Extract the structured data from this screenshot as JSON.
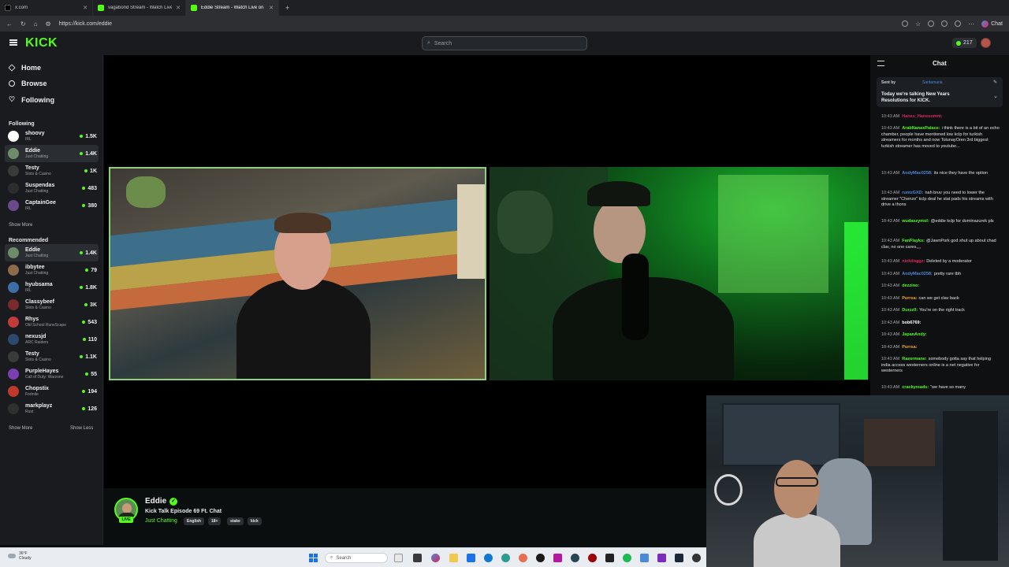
{
  "browser": {
    "tabs": [
      {
        "title": "x.com",
        "active": false,
        "favicon_color": "#000000"
      },
      {
        "title": "vagabond Stream - Watch Live on Kick",
        "active": false,
        "favicon_color": "#53fc18"
      },
      {
        "title": "Eddie Stream - Watch Live on Kick",
        "active": true,
        "favicon_color": "#53fc18"
      }
    ],
    "url": "https://kick.com/eddie",
    "chat_label": "Chat"
  },
  "header": {
    "logo": "KICK",
    "search_placeholder": "Search",
    "viewers": "217"
  },
  "sidebar": {
    "nav": [
      {
        "label": "Home",
        "icon": "home-icon"
      },
      {
        "label": "Browse",
        "icon": "compass-icon"
      },
      {
        "label": "Following",
        "icon": "heart-icon"
      }
    ],
    "following_title": "Following",
    "following": [
      {
        "name": "shoovy",
        "category": "IRL",
        "viewers": "1.5K",
        "color": "#ffffff"
      },
      {
        "name": "Eddie",
        "category": "Just Chatting",
        "viewers": "1.4K",
        "color": "#6d8c6a"
      },
      {
        "name": "Testy",
        "category": "Slots & Casino",
        "viewers": "1K",
        "color": "#3a3a3a"
      },
      {
        "name": "Suspendas",
        "category": "Just Chatting",
        "viewers": "483",
        "color": "#2d2d2d"
      },
      {
        "name": "CaptainGee",
        "category": "IRL",
        "viewers": "380",
        "color": "#6b4a8c"
      }
    ],
    "show_more_following": "Show More",
    "recommended_title": "Recommended",
    "recommended": [
      {
        "name": "Eddie",
        "category": "Just Chatting",
        "viewers": "1.4K",
        "color": "#6d8c6a"
      },
      {
        "name": "ibbytee",
        "category": "Just Chatting",
        "viewers": "79",
        "color": "#8c6a4a"
      },
      {
        "name": "hyubsama",
        "category": "IRL",
        "viewers": "1.8K",
        "color": "#3e6ea8"
      },
      {
        "name": "Classybeef",
        "category": "Slots & Casino",
        "viewers": "3K",
        "color": "#7a2a2a"
      },
      {
        "name": "Rhys",
        "category": "Old School RuneScape",
        "viewers": "543",
        "color": "#c23b3b"
      },
      {
        "name": "nexusjd",
        "category": "ARC Raiders",
        "viewers": "110",
        "color": "#2c4a6e"
      },
      {
        "name": "Testy",
        "category": "Slots & Casino",
        "viewers": "1.1K",
        "color": "#3a3a3a"
      },
      {
        "name": "PurpleHayes",
        "category": "Call of Duty: Warzone",
        "viewers": "55",
        "color": "#7b3fb0"
      },
      {
        "name": "Chopstix",
        "category": "Fortnite",
        "viewers": "194",
        "color": "#c0392b"
      },
      {
        "name": "markplayz",
        "category": "Rust",
        "viewers": "126",
        "color": "#2f2f2f"
      }
    ],
    "show_more": "Show More",
    "show_less": "Show Less"
  },
  "stream": {
    "streamer": "Eddie",
    "title": "Kick Talk Episode 69 Ft. Chat",
    "category": "Just Chatting",
    "live": "LIVE",
    "tags": [
      "English",
      "18+",
      "stake",
      "kick"
    ]
  },
  "chat": {
    "title": "Chat",
    "pinned": {
      "sent_by_label": "Sent by",
      "user": "Santamaria",
      "text": "Today we're talking New Years Resolutions for KICK."
    },
    "messages": [
      {
        "time": "10:43 AM",
        "user": "Hanes_Hanesomnt:",
        "color": "#e0245e",
        "text": ""
      },
      {
        "time": "10:43 AM",
        "user": "ArabNanasPalace:",
        "color": "#53fc18",
        "text": "i think there is a bit of an echo chamber, people have mentioned low kclp for turkish streamers for months and now TolunayOren 3rd biggest turkish streamer has moved to youtube..."
      },
      {
        "time": "10:43 AM",
        "user": "AndyMac0258:",
        "color": "#4b8ad6",
        "text": "its nice they have the option"
      },
      {
        "time": "10:43 AM",
        "user": "runtzGXD:",
        "color": "#4b8ad6",
        "text": "nah bruv you need to lower the streamer \"Chenzo\" kclp deal he stat pads his streams with drive a thons"
      },
      {
        "time": "10:43 AM",
        "user": "wudaszymol:",
        "color": "#53fc18",
        "text": "@eddie kclp for dominazurek pls"
      },
      {
        "time": "10:43 AM",
        "user": "FanFlayks:",
        "color": "#53fc18",
        "text": "@JawnPork god shut up about chad clav, no one cares,,,,"
      },
      {
        "time": "10:43 AM",
        "user": "nickdoggz:",
        "color": "#e0245e",
        "text": "Deleted by a moderator"
      },
      {
        "time": "10:43 AM",
        "user": "AndyMac0258:",
        "color": "#4b8ad6",
        "text": "pretty rare tbh"
      },
      {
        "time": "10:43 AM",
        "user": "dezzino:",
        "color": "#53fc18",
        "text": ""
      },
      {
        "time": "10:43 AM",
        "user": "Purrsa:",
        "color": "#f5a623",
        "text": "can we get clav back"
      },
      {
        "time": "10:43 AM",
        "user": "Durzz0:",
        "color": "#53fc18",
        "text": "You're on the right track"
      },
      {
        "time": "10:43 AM",
        "user": "bob6769:",
        "color": "#ffffff",
        "text": ""
      },
      {
        "time": "10:43 AM",
        "user": "JapanAndy:",
        "color": "#53fc18",
        "text": ""
      },
      {
        "time": "10:43 AM",
        "user": "Purrsa:",
        "color": "#f5a623",
        "text": ""
      },
      {
        "time": "10:43 AM",
        "user": "Razormane:",
        "color": "#53fc18",
        "text": "somebody gotta say that helping india access westerners online is a net negative for westerners"
      },
      {
        "time": "10:43 AM",
        "user": "crackyreads:",
        "color": "#53fc18",
        "text": "\"we have so many"
      }
    ]
  },
  "taskbar": {
    "weather_temp": "36°F",
    "weather_desc": "Cloudy",
    "search_placeholder": "Search"
  },
  "colors": {
    "accent": "#53fc18",
    "bg": "#0b0e0f",
    "panel": "#191b1f"
  }
}
